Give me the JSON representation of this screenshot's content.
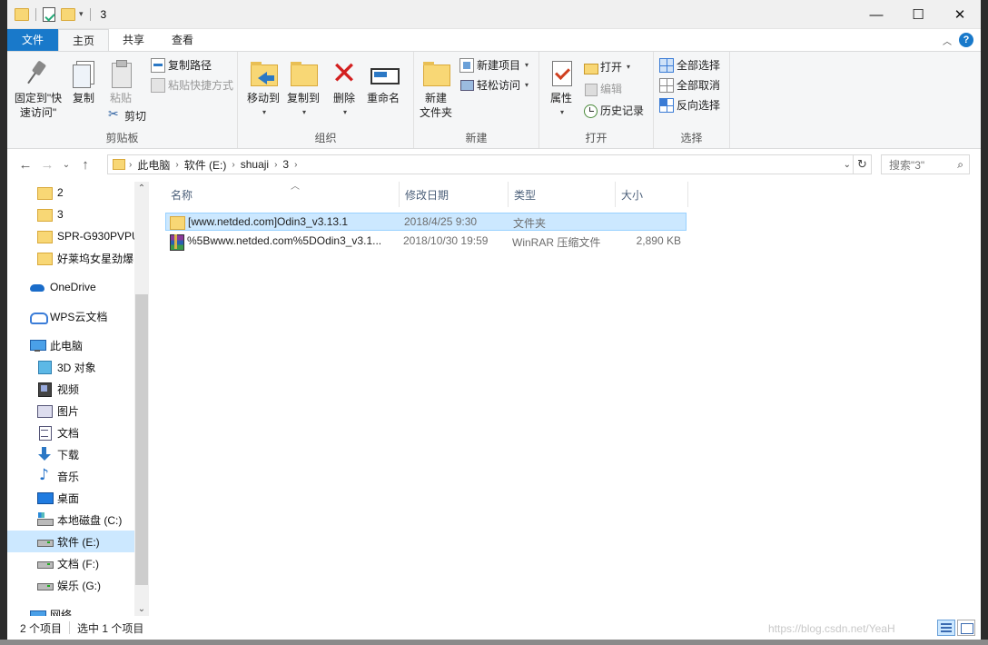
{
  "window": {
    "title": "3",
    "minimize": "—",
    "maximize": "☐",
    "close": "✕"
  },
  "tabs": {
    "file": "文件",
    "home": "主页",
    "share": "共享",
    "view": "查看"
  },
  "ribbon": {
    "clipboard": {
      "label": "剪贴板",
      "pin": "固定到\"快\n速访问\"",
      "copy": "复制",
      "paste": "粘贴",
      "copy_path": "复制路径",
      "paste_shortcut": "粘贴快捷方式",
      "cut": "剪切"
    },
    "organize": {
      "label": "组织",
      "move_to": "移动到",
      "copy_to": "复制到",
      "delete": "删除",
      "rename": "重命名"
    },
    "new": {
      "label": "新建",
      "new_folder_1": "新建",
      "new_folder_2": "文件夹",
      "new_item": "新建项目",
      "easy_access": "轻松访问"
    },
    "open": {
      "label": "打开",
      "properties": "属性",
      "open": "打开",
      "edit": "编辑",
      "history": "历史记录"
    },
    "select": {
      "label": "选择",
      "select_all": "全部选择",
      "select_none": "全部取消",
      "invert": "反向选择"
    }
  },
  "address": {
    "crumbs": [
      "此电脑",
      "软件 (E:)",
      "shuaji",
      "3"
    ],
    "search_placeholder": "搜索\"3\""
  },
  "nav": {
    "items": [
      {
        "label": "2",
        "icon": "folder-icon"
      },
      {
        "label": "3",
        "icon": "folder-icon"
      },
      {
        "label": "SPR-G930PVPU",
        "icon": "folder-icon"
      },
      {
        "label": "好莱坞女星劲爆",
        "icon": "folder-icon"
      },
      {
        "label": "OneDrive",
        "icon": "onedrive-icon"
      },
      {
        "label": "WPS云文档",
        "icon": "wps-cloud-icon"
      },
      {
        "label": "此电脑",
        "icon": "this-pc-icon"
      },
      {
        "label": "3D 对象",
        "icon": "3d-objects-icon"
      },
      {
        "label": "视频",
        "icon": "videos-icon"
      },
      {
        "label": "图片",
        "icon": "pictures-icon"
      },
      {
        "label": "文档",
        "icon": "documents-icon"
      },
      {
        "label": "下载",
        "icon": "downloads-icon"
      },
      {
        "label": "音乐",
        "icon": "music-icon"
      },
      {
        "label": "桌面",
        "icon": "desktop-icon"
      },
      {
        "label": "本地磁盘 (C:)",
        "icon": "system-drive-icon"
      },
      {
        "label": "软件 (E:)",
        "icon": "drive-icon"
      },
      {
        "label": "文档 (F:)",
        "icon": "drive-icon"
      },
      {
        "label": "娱乐 (G:)",
        "icon": "drive-icon"
      },
      {
        "label": "网络",
        "icon": "network-icon"
      }
    ]
  },
  "columns": {
    "name": "名称",
    "date": "修改日期",
    "type": "类型",
    "size": "大小"
  },
  "files": [
    {
      "name": "[www.netded.com]Odin3_v3.13.1",
      "date": "2018/4/25 9:30",
      "type": "文件夹",
      "size": "",
      "icon": "folder-icon",
      "selected": true
    },
    {
      "name": "%5Bwww.netded.com%5DOdin3_v3.1...",
      "date": "2018/10/30 19:59",
      "type": "WinRAR 压缩文件",
      "size": "2,890 KB",
      "icon": "winrar-archive-icon",
      "selected": false
    }
  ],
  "status": {
    "item_count": "2 个项目",
    "selected": "选中 1 个项目",
    "watermark": "https://blog.csdn.net/YeaH"
  }
}
